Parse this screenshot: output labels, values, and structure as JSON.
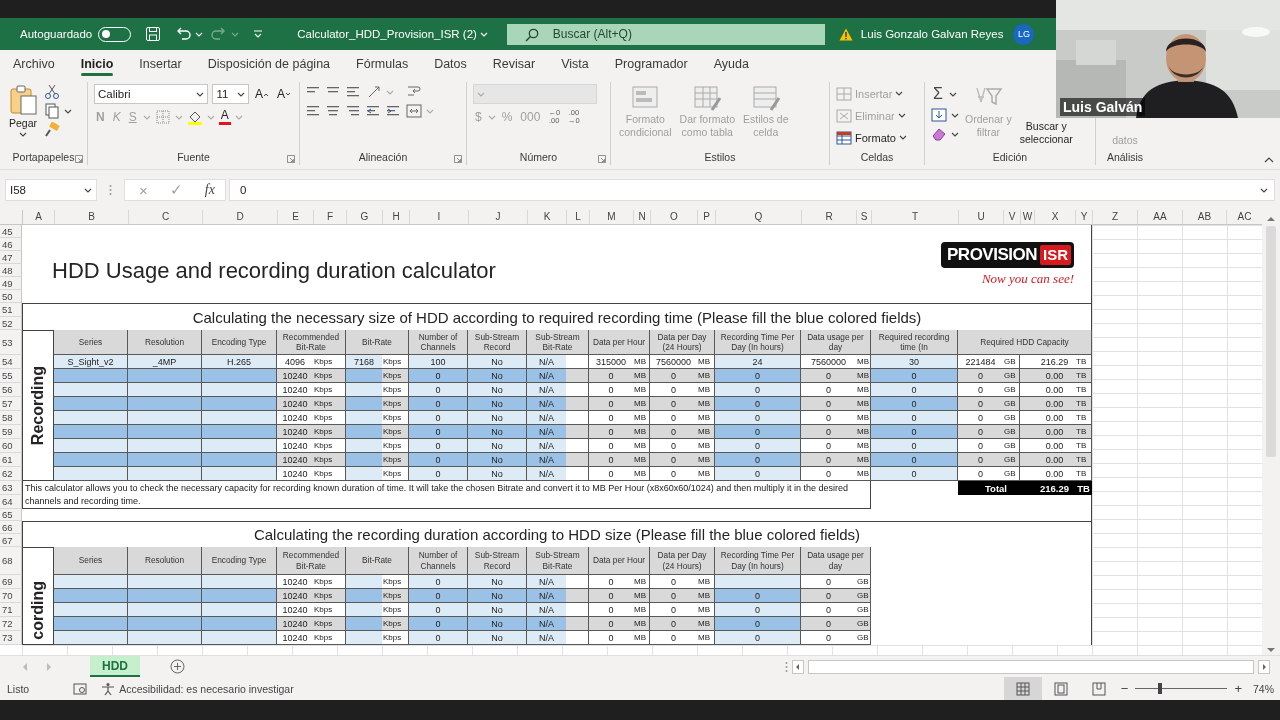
{
  "title_bar": {
    "autosave_label": "Autoguardado",
    "autosave_on": false,
    "history": [
      {
        "kind": "undo",
        "disabled": false
      },
      {
        "kind": "redo",
        "disabled": true
      }
    ],
    "file_name": "Calculator_HDD_Provision_ISR (2)",
    "search": {
      "placeholder": "Buscar (Alt+Q)"
    },
    "user_name": "Luis Gonzalo Galvan Reyes",
    "avatar": "LG"
  },
  "menu_tabs": [
    {
      "label": "Archivo",
      "selected": false
    },
    {
      "label": "Inicio",
      "selected": true
    },
    {
      "label": "Insertar",
      "selected": false
    },
    {
      "label": "Disposición de página",
      "selected": false
    },
    {
      "label": "Fórmulas",
      "selected": false
    },
    {
      "label": "Datos",
      "selected": false
    },
    {
      "label": "Revisar",
      "selected": false
    },
    {
      "label": "Vista",
      "selected": false
    },
    {
      "label": "Programador",
      "selected": false
    },
    {
      "label": "Ayuda",
      "selected": false
    }
  ],
  "ribbon": {
    "clipboard": {
      "paste": "Pegar",
      "group": "Portapapeles"
    },
    "font": {
      "family": "Calibri",
      "size": "11",
      "grow": "A",
      "shrink": "A",
      "styles": [
        {
          "label": "N",
          "kind": "bold",
          "disabled": true
        },
        {
          "label": "K",
          "kind": "italic",
          "disabled": true
        },
        {
          "label": "S",
          "kind": "underline",
          "disabled": true
        }
      ],
      "font_color": "A",
      "group": "Fuente"
    },
    "alignment": {
      "group": "Alineación"
    },
    "number": {
      "currency": "$",
      "percent": "%",
      "thousands": "000",
      "decimals": [
        {
          "top": "←0",
          "bottom": ".00"
        },
        {
          "top": ".00",
          "bottom": "→0"
        }
      ],
      "group": "Número"
    },
    "styles": {
      "buttons": [
        {
          "lines": [
            "Formato",
            "condicional"
          ],
          "kind": "conditional",
          "disabled": true
        },
        {
          "lines": [
            "Dar formato",
            "como tabla"
          ],
          "kind": "table",
          "disabled": true
        },
        {
          "lines": [
            "Estilos de",
            "celda"
          ],
          "kind": "cell",
          "disabled": true
        }
      ],
      "group": "Estilos"
    },
    "cells": {
      "buttons": [
        {
          "label": "Insertar",
          "kind": "insert",
          "disabled": true
        },
        {
          "label": "Eliminar",
          "kind": "delete",
          "disabled": true
        },
        {
          "label": "Formato",
          "kind": "format",
          "disabled": false
        }
      ],
      "group": "Celdas"
    },
    "editing": {
      "sum": "Σ",
      "buttons": [
        {
          "lines": [
            "Ordenar y",
            "filtrar"
          ],
          "kind": "sort",
          "disabled": true
        },
        {
          "lines": [
            "Buscar y",
            "seleccionar"
          ],
          "kind": "find",
          "disabled": false
        }
      ],
      "group": "Edición"
    },
    "analysis": {
      "label": "datos",
      "disabled": true,
      "group": "Análisis"
    }
  },
  "formula_bar": {
    "name_box": "I58",
    "cancel": "×",
    "enter": "✓",
    "function": "fx",
    "value": "0"
  },
  "sheet": {
    "columns": [
      "A",
      "B",
      "C",
      "D",
      "E",
      "F",
      "G",
      "H",
      "I",
      "J",
      "K",
      "L",
      "M",
      "N",
      "O",
      "P",
      "Q",
      "R",
      "S",
      "T",
      "U",
      "V",
      "W",
      "X",
      "Y",
      "Z",
      "AA",
      "AB",
      "AC"
    ],
    "row_numbers": [
      "45",
      "46",
      "47",
      "48",
      "49",
      "50",
      "51",
      "52",
      "53",
      "54",
      "55",
      "56",
      "57",
      "58",
      "59",
      "60",
      "61",
      "62",
      "63",
      "64",
      "65",
      "66",
      "67",
      "68",
      "69",
      "70",
      "71",
      "72",
      "73"
    ],
    "title": "HDD Usage and recording duration calculator",
    "logo": {
      "brand": "PROVISION",
      "mark": "ISR",
      "tagline": "Now you can see!"
    },
    "sections": [
      {
        "heading": "Calculating the necessary size of HDD according to required recording time (Please fill the blue colored fields)",
        "side_label": "Recording",
        "headers": [
          "Series",
          "Resolution",
          "Encoding Type",
          "Recommended Bit-Rate",
          "Bit-Rate",
          "Number of Channels",
          "Sub-Stream Record",
          "Sub-Stream Bit-Rate",
          "Data per Hour",
          "Data per Day (24 Hours)",
          "Recording Time Per Day (In hours)",
          "Data usage per day",
          "Required recording time (In",
          "Required HDD Capacity"
        ],
        "rows": [
          [
            "S_Sight_v2",
            "_4MP",
            "H.265",
            "4096",
            "Kbps",
            "7168",
            "Kbps",
            "100",
            "No",
            "N/A",
            "315000",
            "MB",
            "7560000",
            "MB",
            "24",
            "7560000",
            "MB",
            "30",
            "221484",
            "GB",
            "216.29",
            "TB"
          ],
          [
            null,
            null,
            null,
            "10240",
            "Kbps",
            null,
            "Kbps",
            "0",
            "No",
            "N/A",
            "0",
            "MB",
            "0",
            "MB",
            "0",
            "0",
            "MB",
            "0",
            "0",
            "GB",
            "0.00",
            "TB"
          ],
          [
            null,
            null,
            null,
            "10240",
            "Kbps",
            null,
            "Kbps",
            "0",
            "No",
            "N/A",
            "0",
            "MB",
            "0",
            "MB",
            "0",
            "0",
            "MB",
            "0",
            "0",
            "GB",
            "0.00",
            "TB"
          ],
          [
            null,
            null,
            null,
            "10240",
            "Kbps",
            null,
            "Kbps",
            "0",
            "No",
            "N/A",
            "0",
            "MB",
            "0",
            "MB",
            "0",
            "0",
            "MB",
            "0",
            "0",
            "GB",
            "0.00",
            "TB"
          ],
          [
            null,
            null,
            null,
            "10240",
            "Kbps",
            null,
            "Kbps",
            "0",
            "No",
            "N/A",
            "0",
            "MB",
            "0",
            "MB",
            "0",
            "0",
            "MB",
            "0",
            "0",
            "GB",
            "0.00",
            "TB"
          ],
          [
            null,
            null,
            null,
            "10240",
            "Kbps",
            null,
            "Kbps",
            "0",
            "No",
            "N/A",
            "0",
            "MB",
            "0",
            "MB",
            "0",
            "0",
            "MB",
            "0",
            "0",
            "GB",
            "0.00",
            "TB"
          ],
          [
            null,
            null,
            null,
            "10240",
            "Kbps",
            null,
            "Kbps",
            "0",
            "No",
            "N/A",
            "0",
            "MB",
            "0",
            "MB",
            "0",
            "0",
            "MB",
            "0",
            "0",
            "GB",
            "0.00",
            "TB"
          ],
          [
            null,
            null,
            null,
            "10240",
            "Kbps",
            null,
            "Kbps",
            "0",
            "No",
            "N/A",
            "0",
            "MB",
            "0",
            "MB",
            "0",
            "0",
            "MB",
            "0",
            "0",
            "GB",
            "0.00",
            "TB"
          ],
          [
            null,
            null,
            null,
            "10240",
            "Kbps",
            null,
            "Kbps",
            "0",
            "No",
            "N/A",
            "0",
            "MB",
            "0",
            "MB",
            "0",
            "0",
            "MB",
            "0",
            "0",
            "GB",
            "0.00",
            "TB"
          ]
        ]
      },
      {
        "heading": "Calculating the recording duration according to HDD size (Please fill the blue colored fields)",
        "side_label": "cording",
        "headers": [
          "Series",
          "Resolution",
          "Encoding Type",
          "Recommended Bit-Rate",
          "Bit-Rate",
          "Number of Channels",
          "Sub-Stream Record",
          "Sub-Stream Bit-Rate",
          "Data per Hour",
          "Data per Day (24 Hours)",
          "Recording Time Per Day (In hours)",
          "Data usage per day"
        ],
        "rows": [
          [
            null,
            null,
            null,
            "10240",
            "Kbps",
            null,
            "Kbps",
            "0",
            "No",
            "N/A",
            "0",
            "MB",
            "0",
            "MB",
            null,
            "0",
            "GB"
          ],
          [
            null,
            null,
            null,
            "10240",
            "Kbps",
            null,
            "Kbps",
            "0",
            "No",
            "N/A",
            "0",
            "MB",
            "0",
            "MB",
            "0",
            "0",
            "GB"
          ],
          [
            null,
            null,
            null,
            "10240",
            "Kbps",
            null,
            "Kbps",
            "0",
            "No",
            "N/A",
            "0",
            "MB",
            "0",
            "MB",
            "0",
            "0",
            "GB"
          ],
          [
            null,
            null,
            null,
            "10240",
            "Kbps",
            null,
            "Kbps",
            "0",
            "No",
            "N/A",
            "0",
            "MB",
            "0",
            "MB",
            "0",
            "0",
            "GB"
          ],
          [
            null,
            null,
            null,
            "10240",
            "Kbps",
            null,
            "Kbps",
            "0",
            "No",
            "N/A",
            "0",
            "MB",
            "0",
            "MB",
            "0",
            "0",
            "GB"
          ]
        ]
      }
    ],
    "note": "This calculator allows you to check the necessary capacity for recording known duration of time. It will take the chosen Bitrate and convert it to MB Per Hour (x8x60x60/1024) and then multiply it in the desired channels and recording time.",
    "total": {
      "label": "Total",
      "value": "216.29",
      "unit": "TB"
    }
  },
  "sheet_tabs": [
    {
      "label": "HDD",
      "selected": true
    }
  ],
  "status_bar": {
    "ready": "Listo",
    "accessibility": "Accesibilidad: es necesario investigar",
    "views": [
      {
        "kind": "normal",
        "selected": true
      },
      {
        "kind": "layout",
        "selected": false
      },
      {
        "kind": "break",
        "selected": false
      }
    ],
    "zoom_out": "−",
    "zoom_in": "+",
    "zoom": {
      "level": 0.27
    },
    "zoom_text": "74%"
  },
  "webcam": {
    "name": "Luis Galván"
  }
}
